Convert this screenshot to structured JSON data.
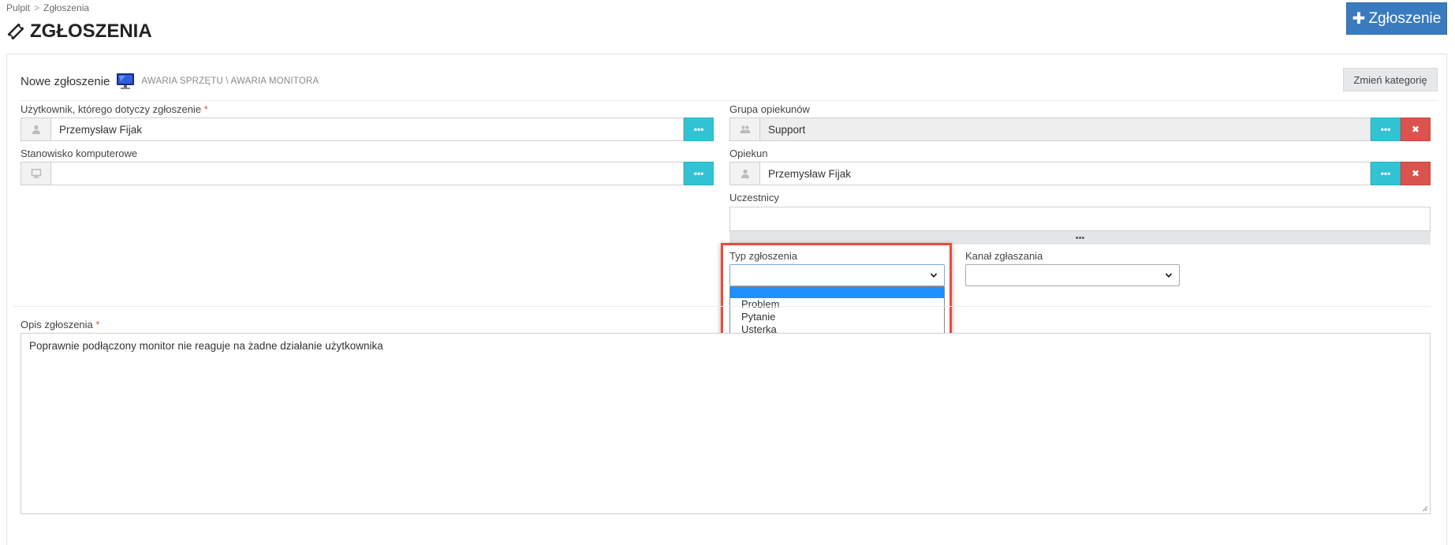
{
  "breadcrumb": {
    "items": [
      "Pulpit",
      "Zgłoszenia"
    ],
    "separator": ">"
  },
  "page": {
    "title": "ZGŁOSZENIA",
    "new_button": "Zgłoszenie"
  },
  "form_header": {
    "title": "Nowe zgłoszenie",
    "category_path": "AWARIA SPRZĘTU \\ AWARIA MONITORA",
    "change_category_button": "Zmień kategorię"
  },
  "fields": {
    "user": {
      "label": "Użytkownik, którego dotyczy zgłoszenie",
      "required_mark": "*",
      "value": "Przemysław Fijak",
      "more_button": "•••"
    },
    "workstation": {
      "label": "Stanowisko komputerowe",
      "value": "",
      "more_button": "•••"
    },
    "support_group": {
      "label": "Grupa opiekunów",
      "value": "Support",
      "more_button": "•••",
      "clear_button": "✖"
    },
    "assignee": {
      "label": "Opiekun",
      "value": "Przemysław Fijak",
      "more_button": "•••",
      "clear_button": "✖"
    },
    "participants": {
      "label": "Uczestnicy",
      "value": "",
      "more_button": "•••"
    },
    "ticket_type": {
      "label": "Typ zgłoszenia",
      "selected": "",
      "options": [
        "",
        "Problem",
        "Pytanie",
        "Usterka"
      ]
    },
    "channel": {
      "label": "Kanał zgłaszania",
      "selected": ""
    },
    "description": {
      "label": "Opis zgłoszenia",
      "required_mark": "*",
      "value": "Poprawnie podłączony monitor nie reaguje na żadne działanie użytkownika"
    }
  },
  "colors": {
    "primary": "#3a7bbf",
    "info": "#31c3d3",
    "danger": "#d9534f",
    "highlight": "#e74c3c",
    "dropdown_selected": "#1e90ff"
  },
  "icons": {
    "title": "ticket-icon",
    "category": "monitor-icon",
    "user": "user-icon",
    "workstation": "desktop-icon",
    "group": "users-icon"
  }
}
